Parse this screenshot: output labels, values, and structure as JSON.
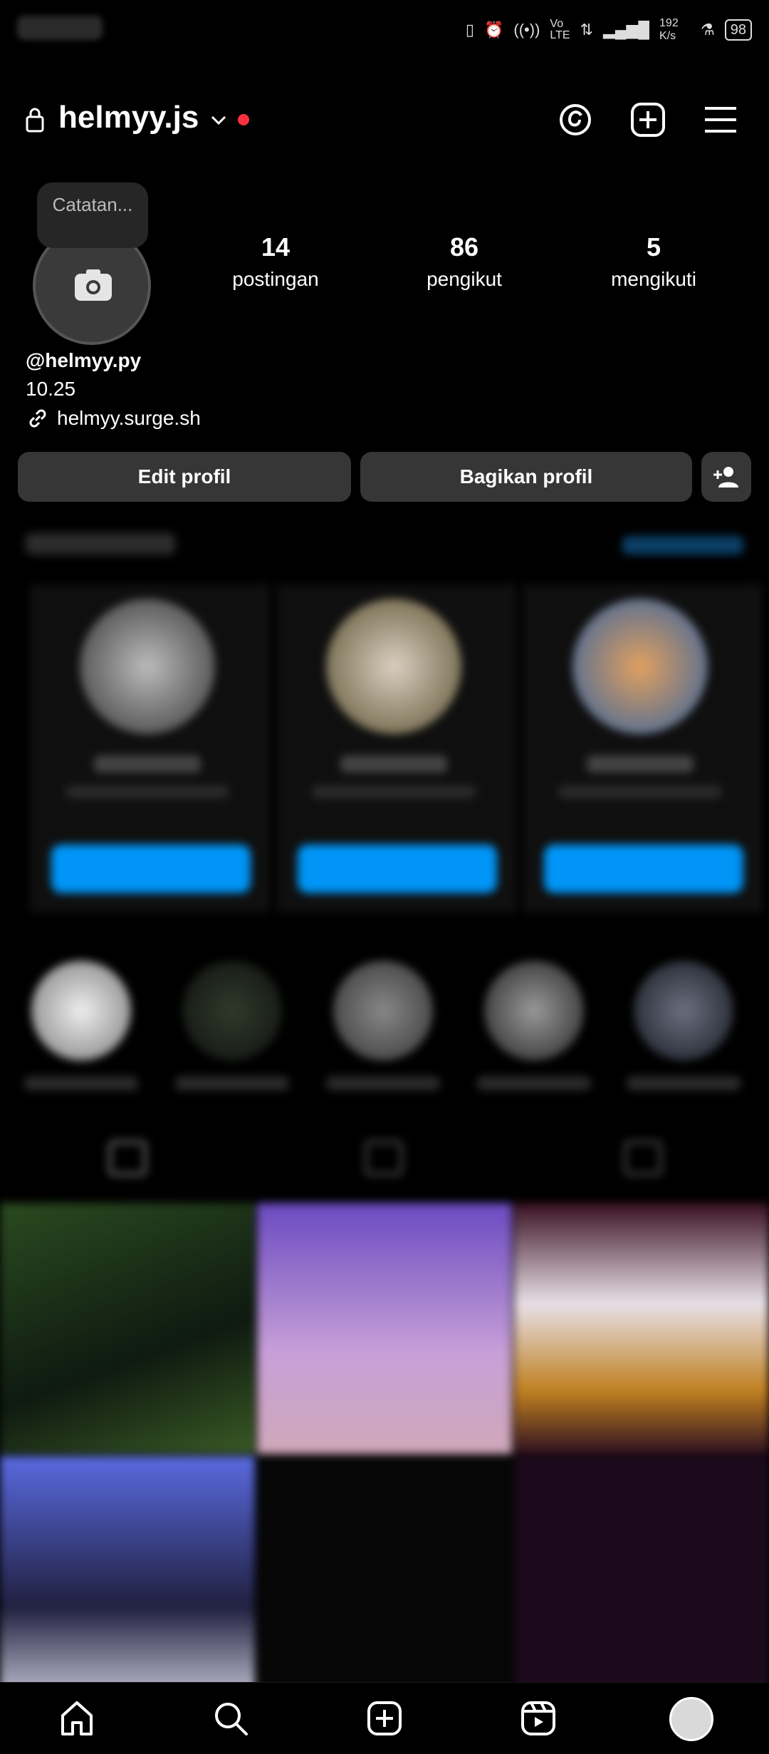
{
  "status_bar": {
    "network_speed": "192 K/s",
    "battery": "98",
    "icons": [
      "vibrate-icon",
      "alarm-icon",
      "hotspot-icon",
      "volte-icon",
      "data-icon",
      "signal-icon",
      "flask-icon"
    ]
  },
  "header": {
    "username": "helmyy.js",
    "icons": [
      "lock-icon",
      "chevron-down-icon",
      "threads-icon",
      "create-icon",
      "menu-icon"
    ],
    "notification_dot_color": "#ff3040"
  },
  "profile": {
    "note": "Catatan...",
    "stats": [
      {
        "value": "14",
        "label": "postingan"
      },
      {
        "value": "86",
        "label": "pengikut"
      },
      {
        "value": "5",
        "label": "mengikuti"
      }
    ],
    "name": "@helmyy.py",
    "bio": "10.25",
    "link": "helmyy.surge.sh"
  },
  "actions": {
    "edit": "Edit profil",
    "share": "Bagikan profil",
    "discover_icon": "add-person-icon"
  },
  "colors": {
    "accent_blue": "#0095f6",
    "button_bg": "#363636",
    "background": "#000000"
  },
  "bottom_nav": [
    "home-icon",
    "search-icon",
    "create-icon",
    "reels-icon",
    "profile-avatar"
  ]
}
